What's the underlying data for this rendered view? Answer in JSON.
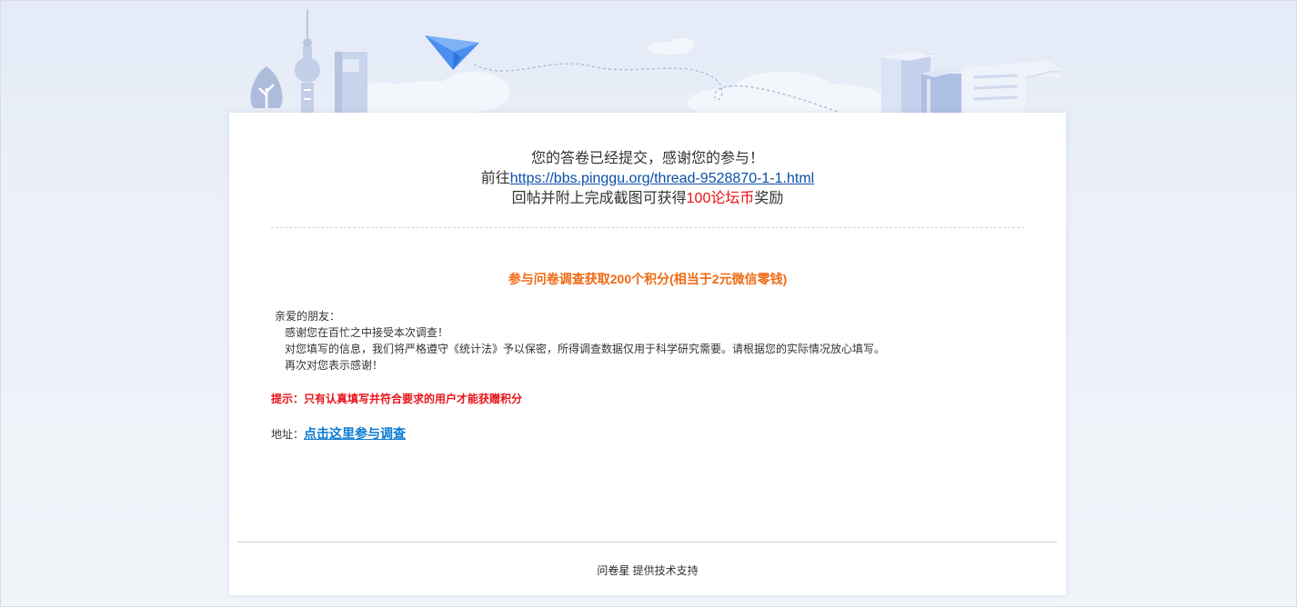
{
  "completion": {
    "line1": "您的答卷已经提交，感谢您的参与！",
    "line2_prefix": "前往",
    "line2_link": "https://bbs.pinggu.org/thread-9528870-1-1.html",
    "line3_prefix": "回帖并附上完成截图可获得",
    "line3_reward": "100论坛币",
    "line3_suffix": "奖励"
  },
  "survey": {
    "title": "参与问卷调查获取200个积分(相当于2元微信零钱)",
    "greeting": "亲爱的朋友：",
    "para1": "感谢您在百忙之中接受本次调查！",
    "para2": "对您填写的信息，我们将严格遵守《统计法》予以保密，所得调查数据仅用于科学研究需要。请根据您的实际情况放心填写。",
    "para3": "再次对您表示感谢！",
    "tip": "提示：只有认真填写并符合要求的用户才能获赠积分",
    "address_label": "地址：",
    "address_link": "点击这里参与调查"
  },
  "footer": {
    "brand": "问卷星",
    "text": " 提供技术支持"
  },
  "colors": {
    "accent_link": "#0b4fa8",
    "reward_red": "#ee1010",
    "title_orange": "#f06a14",
    "tip_red": "#e8141b",
    "survey_link": "#0b7ad1"
  },
  "icons": [
    "tower-icon",
    "tree-icon",
    "building-icon",
    "paper-plane-icon",
    "books-icon",
    "document-icon",
    "cloud-icon"
  ]
}
